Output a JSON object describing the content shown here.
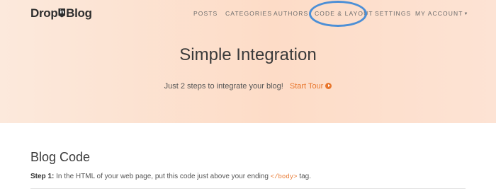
{
  "brand": {
    "part1": "Drop",
    "badge": "in",
    "part2": "Blog"
  },
  "nav": {
    "posts": "POSTS",
    "categories": "CATEGORIES",
    "authors": "AUTHORS",
    "code_layout": "CODE & LAYOUT",
    "settings": "SETTINGS",
    "account": "MY ACCOUNT"
  },
  "hero": {
    "title": "Simple Integration",
    "subtitle": "Just 2 steps to integrate your blog!",
    "tour_label": "Start Tour"
  },
  "section": {
    "title": "Blog Code",
    "step_label": "Step 1:",
    "step_text_before": "In the HTML of your web page, put this code just above your ending",
    "step_code": "</body>",
    "step_text_after": "tag."
  },
  "colors": {
    "accent": "#e8762d",
    "highlight_ring": "#4c8fd6"
  },
  "icons": {
    "tour": "play-circle-icon",
    "account_caret": "caret-down-icon"
  }
}
